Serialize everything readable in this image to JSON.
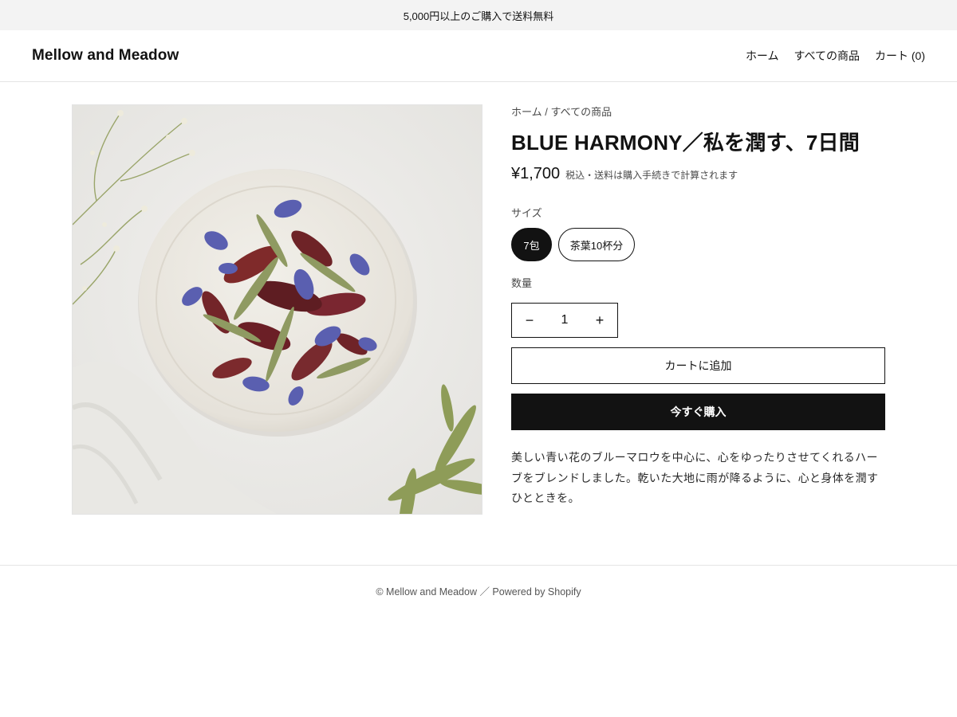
{
  "announcement": "5,000円以上のご購入で送料無料",
  "header": {
    "logo": "Mellow and Meadow",
    "nav": [
      "ホーム",
      "すべての商品",
      "カート (0)"
    ]
  },
  "product": {
    "breadcrumb": [
      "ホーム",
      "すべての商品"
    ],
    "breadcrumb_separator": "/",
    "title": "BLUE HARMONY／私を潤す、7日間",
    "price": "¥1,700",
    "tax_note": "税込・送料は購入手続きで計算されます",
    "size_label": "サイズ",
    "sizes": [
      {
        "label": "7包",
        "selected": true
      },
      {
        "label": "茶葉10杯分",
        "selected": false
      }
    ],
    "quantity_label": "数量",
    "quantity": {
      "minus": "−",
      "value": "1",
      "plus": "+"
    },
    "add_to_cart": "カートに追加",
    "buy_now": "今すぐ購入",
    "description": "美しい青い花のブルーマロウを中心に、心をゆったりさせてくれるハーブをブレンドしました。乾いた大地に雨が降るように、心と身体を潤すひとときを。"
  },
  "footer": "© Mellow and Meadow ／ Powered by Shopify",
  "colors": {
    "accent": "#121212",
    "announcement_bg": "#f3f3f3",
    "muted_text": "#4a4a4a"
  }
}
